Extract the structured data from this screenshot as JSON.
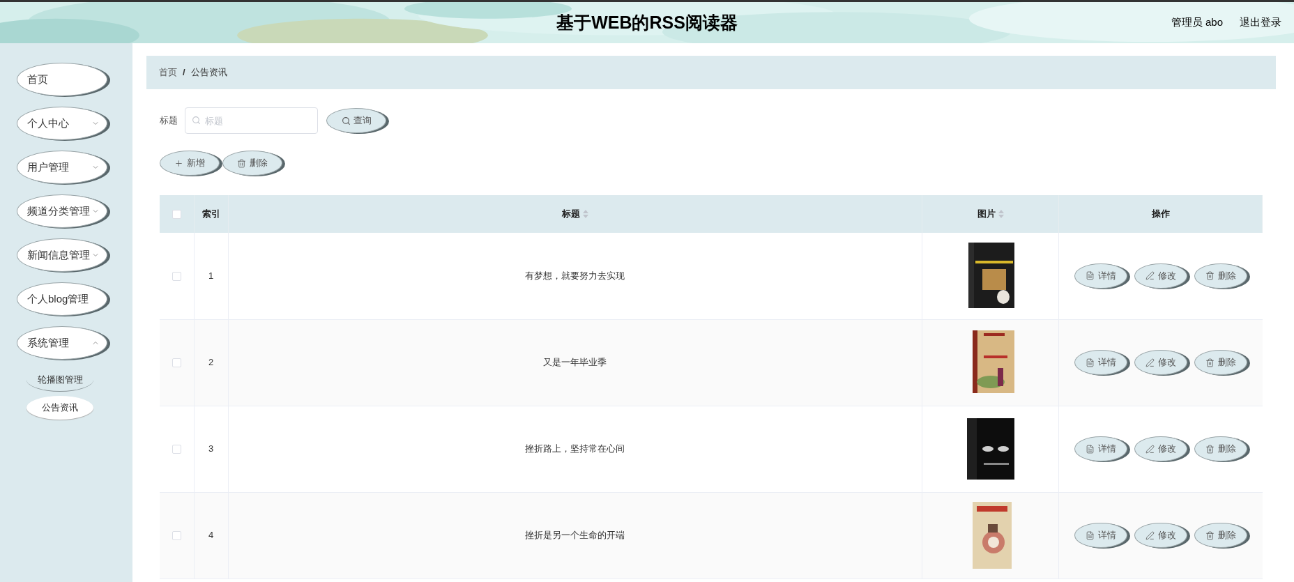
{
  "header": {
    "title": "基于WEB的RSS阅读器",
    "user": "管理员 abo",
    "logout": "退出登录"
  },
  "sidebar": {
    "items": [
      {
        "label": "首页",
        "kind": "link"
      },
      {
        "label": "个人中心",
        "kind": "menu",
        "expanded": false
      },
      {
        "label": "用户管理",
        "kind": "menu",
        "expanded": false
      },
      {
        "label": "频道分类管理",
        "kind": "menu",
        "expanded": false
      },
      {
        "label": "新闻信息管理",
        "kind": "menu",
        "expanded": false
      },
      {
        "label": "个人blog管理",
        "kind": "link"
      },
      {
        "label": "系统管理",
        "kind": "menu",
        "expanded": true,
        "children": [
          {
            "label": "轮播图管理",
            "selected": false
          },
          {
            "label": "公告资讯",
            "selected": true
          }
        ]
      }
    ]
  },
  "breadcrumb": {
    "items": [
      "首页",
      "公告资讯"
    ],
    "separator": "/"
  },
  "search": {
    "label": "标题",
    "placeholder": "标题",
    "button": "查询"
  },
  "toolbar": [
    {
      "kind": "add",
      "label": "新增"
    },
    {
      "kind": "delete",
      "label": "删除"
    }
  ],
  "table": {
    "select_all": {
      "checked": false
    },
    "columns": [
      {
        "label": "索引",
        "sortable": false
      },
      {
        "label": "标题",
        "sortable": true
      },
      {
        "label": "图片",
        "sortable": true
      },
      {
        "label": "操作",
        "sortable": false
      }
    ],
    "rows": [
      {
        "checked": false,
        "index": "1",
        "title": "有梦想，就要努力去实现",
        "actions": [
          {
            "kind": "detail",
            "label": "详情"
          },
          {
            "kind": "edit",
            "label": "修改"
          },
          {
            "kind": "delete",
            "label": "删除"
          }
        ]
      },
      {
        "checked": false,
        "index": "2",
        "title": "又是一年毕业季",
        "actions": [
          {
            "kind": "detail",
            "label": "详情"
          },
          {
            "kind": "edit",
            "label": "修改"
          },
          {
            "kind": "delete",
            "label": "删除"
          }
        ]
      },
      {
        "checked": false,
        "index": "3",
        "title": "挫折路上，坚持常在心间",
        "actions": [
          {
            "kind": "detail",
            "label": "详情"
          },
          {
            "kind": "edit",
            "label": "修改"
          },
          {
            "kind": "delete",
            "label": "删除"
          }
        ]
      },
      {
        "checked": false,
        "index": "4",
        "title": "挫折是另一个生命的开端",
        "actions": [
          {
            "kind": "detail",
            "label": "详情"
          },
          {
            "kind": "edit",
            "label": "修改"
          },
          {
            "kind": "delete",
            "label": "删除"
          }
        ]
      }
    ]
  }
}
